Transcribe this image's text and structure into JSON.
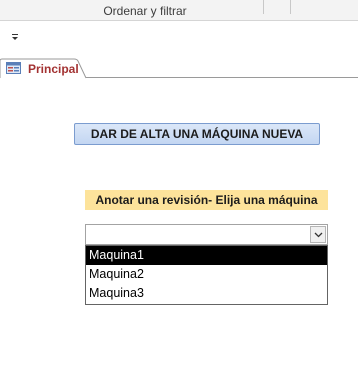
{
  "ribbon": {
    "group_label": "Ordenar y filtrar"
  },
  "quick_access": {
    "customize_icon": "customize-quick-access-icon"
  },
  "tabs": [
    {
      "label": "Principal",
      "icon": "form-icon",
      "active": true
    }
  ],
  "form": {
    "add_button_label": "DAR DE ALTA UNA MÁQUINA NUEVA",
    "revision_label": "Anotar una revisión- Elija una máquina",
    "machine_combo": {
      "value": "",
      "options": [
        "Maquina1",
        "Maquina2",
        "Maquina3"
      ],
      "highlighted": "Maquina1"
    }
  },
  "colors": {
    "tab_label": "#a33232",
    "label_background": "#fde39b",
    "button_background": "#c3d6f2",
    "selected_option": "#000000"
  }
}
